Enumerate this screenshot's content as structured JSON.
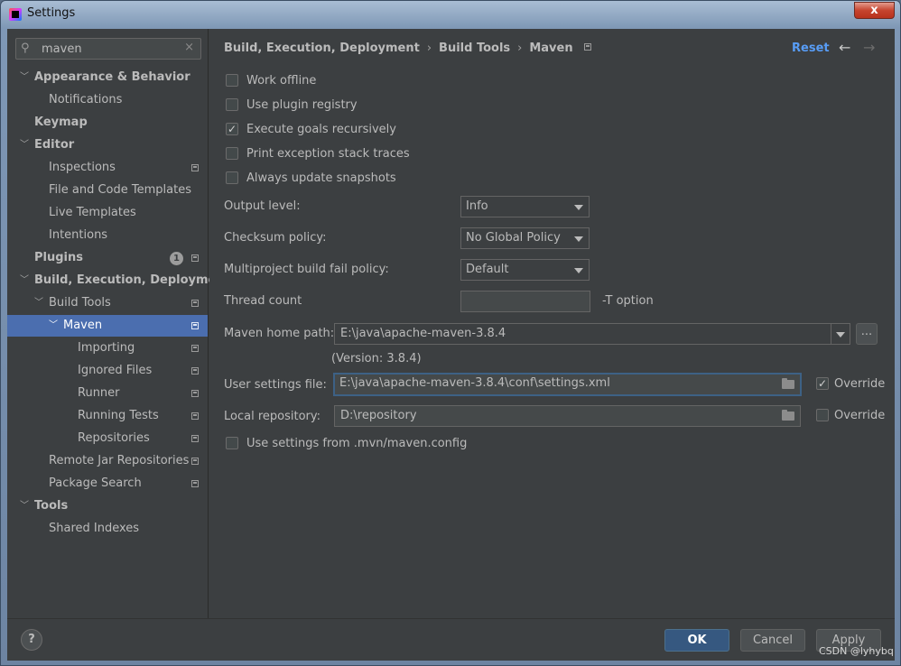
{
  "window": {
    "title": "Settings",
    "close_glyph": "x"
  },
  "search": {
    "value": "maven",
    "placeholder": ""
  },
  "sidebar": {
    "items": [
      {
        "label": "Appearance & Behavior",
        "expanded": true
      },
      {
        "label": "Notifications"
      },
      {
        "label": "Keymap"
      },
      {
        "label": "Editor",
        "expanded": true
      },
      {
        "label": "Inspections"
      },
      {
        "label": "File and Code Templates"
      },
      {
        "label": "Live Templates"
      },
      {
        "label": "Intentions"
      },
      {
        "label": "Plugins",
        "badge": "1"
      },
      {
        "label": "Build, Execution, Deployment",
        "expanded": true
      },
      {
        "label": "Build Tools",
        "expanded": true
      },
      {
        "label": "Maven",
        "expanded": true,
        "selected": true
      },
      {
        "label": "Importing"
      },
      {
        "label": "Ignored Files"
      },
      {
        "label": "Runner"
      },
      {
        "label": "Running Tests"
      },
      {
        "label": "Repositories"
      },
      {
        "label": "Remote Jar Repositories"
      },
      {
        "label": "Package Search"
      },
      {
        "label": "Tools",
        "expanded": true
      },
      {
        "label": "Shared Indexes"
      }
    ]
  },
  "breadcrumb": {
    "part1": "Build, Execution, Deployment",
    "part2": "Build Tools",
    "part3": "Maven",
    "sep": "›"
  },
  "header": {
    "reset_label": "Reset",
    "back_glyph": "←",
    "forward_glyph": "→"
  },
  "options": {
    "work_offline": {
      "label": "Work offline",
      "checked": false
    },
    "use_plugin_registry": {
      "label": "Use plugin registry",
      "checked": false
    },
    "execute_goals_recursively": {
      "label": "Execute goals recursively",
      "checked": true
    },
    "print_exception_stack_traces": {
      "label": "Print exception stack traces",
      "checked": false
    },
    "always_update_snapshots": {
      "label": "Always update snapshots",
      "checked": false
    }
  },
  "form": {
    "output_level": {
      "label": "Output level:",
      "value": "Info"
    },
    "checksum_policy": {
      "label": "Checksum policy:",
      "value": "No Global Policy"
    },
    "fail_policy": {
      "label": "Multiproject build fail policy:",
      "value": "Default"
    },
    "thread_count": {
      "label": "Thread count",
      "value": "",
      "suffix": "-T option"
    },
    "maven_home": {
      "label": "Maven home path:",
      "value": "E:\\java\\apache-maven-3.8.4",
      "version": "(Version: 3.8.4)",
      "browse": "..."
    },
    "user_settings": {
      "label": "User settings file:",
      "value": "E:\\java\\apache-maven-3.8.4\\conf\\settings.xml",
      "override_label": "Override",
      "override_checked": true
    },
    "local_repo": {
      "label": "Local repository:",
      "value": "D:\\repository",
      "override_label": "Override",
      "override_checked": false
    },
    "mvn_config": {
      "label": "Use settings from .mvn/maven.config",
      "checked": false
    }
  },
  "footer": {
    "help_label": "?",
    "ok_label": "OK",
    "cancel_label": "Cancel",
    "apply_label": "Apply"
  },
  "watermark": "CSDN @lyhybq",
  "colors": {
    "accent": "#4b6eaf",
    "link": "#589df6",
    "background": "#3c3f41",
    "primary_button": "#365880"
  }
}
